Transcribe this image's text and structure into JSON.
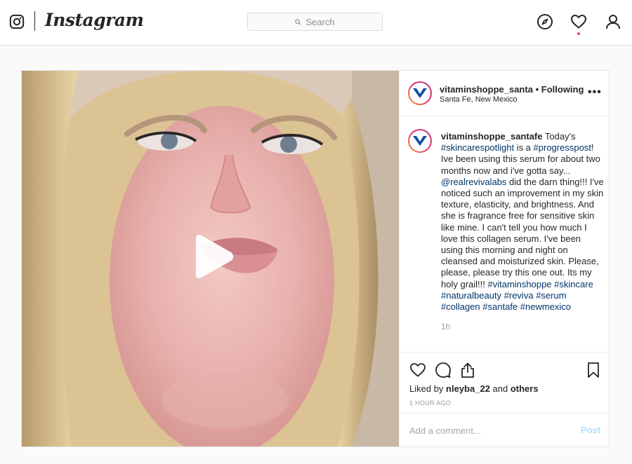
{
  "header": {
    "logo_icon": "instagram-glyph-icon",
    "wordmark": "Instagram",
    "search": {
      "placeholder": "Search",
      "icon": "search-icon"
    },
    "nav_icons": [
      "explore-compass-icon",
      "activity-heart-icon",
      "profile-person-icon"
    ],
    "notification_dot_color": "#ed4956"
  },
  "post": {
    "media": {
      "type": "video",
      "play_icon": "play-icon"
    },
    "header": {
      "username": "vitaminshoppe_santa",
      "separator": "•",
      "following": "Following",
      "location": "Santa Fe, New Mexico",
      "more_icon": "more-horizontal-icon",
      "more_label": "•••"
    },
    "caption": {
      "username": "vitaminshoppe_santafe",
      "segments": [
        {
          "text": "Today's ",
          "tag": false
        },
        {
          "text": "#skincarespotlight",
          "tag": true
        },
        {
          "text": " is a ",
          "tag": false
        },
        {
          "text": "#progresspost",
          "tag": true
        },
        {
          "text": "! Ive been using this serum for about two months now and i've gotta say... ",
          "tag": false
        },
        {
          "text": "@realrevivalabs",
          "tag": true
        },
        {
          "text": " did the darn thing!!! I've noticed such an improvement in my skin texture, elasticity, and brightness. And she is fragrance free for sensitive skin like mine. I can't tell you how much I love this collagen serum. I've been using this morning and night on cleansed and moisturized skin. Please, please, please try this one out. Its my holy grail!!! ",
          "tag": false
        },
        {
          "text": "#vitaminshoppe",
          "tag": true
        },
        {
          "text": " ",
          "tag": false
        },
        {
          "text": "#skincare",
          "tag": true
        },
        {
          "text": " ",
          "tag": false
        },
        {
          "text": "#naturalbeauty",
          "tag": true
        },
        {
          "text": " ",
          "tag": false
        },
        {
          "text": "#reviva",
          "tag": true
        },
        {
          "text": " ",
          "tag": false
        },
        {
          "text": "#serum",
          "tag": true
        },
        {
          "text": " ",
          "tag": false
        },
        {
          "text": "#collagen",
          "tag": true
        },
        {
          "text": " ",
          "tag": false
        },
        {
          "text": "#santafe",
          "tag": true
        },
        {
          "text": " ",
          "tag": false
        },
        {
          "text": "#newmexico",
          "tag": true
        }
      ],
      "time": "1h"
    },
    "actions": {
      "icons": [
        "like-heart-icon",
        "comment-bubble-icon",
        "share-icon",
        "save-bookmark-icon"
      ],
      "liked_by_prefix": "Liked by ",
      "liked_by_user": "nleyba_22",
      "liked_by_and": " and ",
      "liked_by_others": "others",
      "timestamp": "1 HOUR AGO"
    },
    "comment": {
      "placeholder": "Add a comment...",
      "post_label": "Post"
    }
  },
  "colors": {
    "link": "#003569",
    "post_button_disabled": "#b2dffc",
    "muted_text": "#999999",
    "border": "#dbdbdb",
    "brand_v": "#0d4ea3"
  }
}
